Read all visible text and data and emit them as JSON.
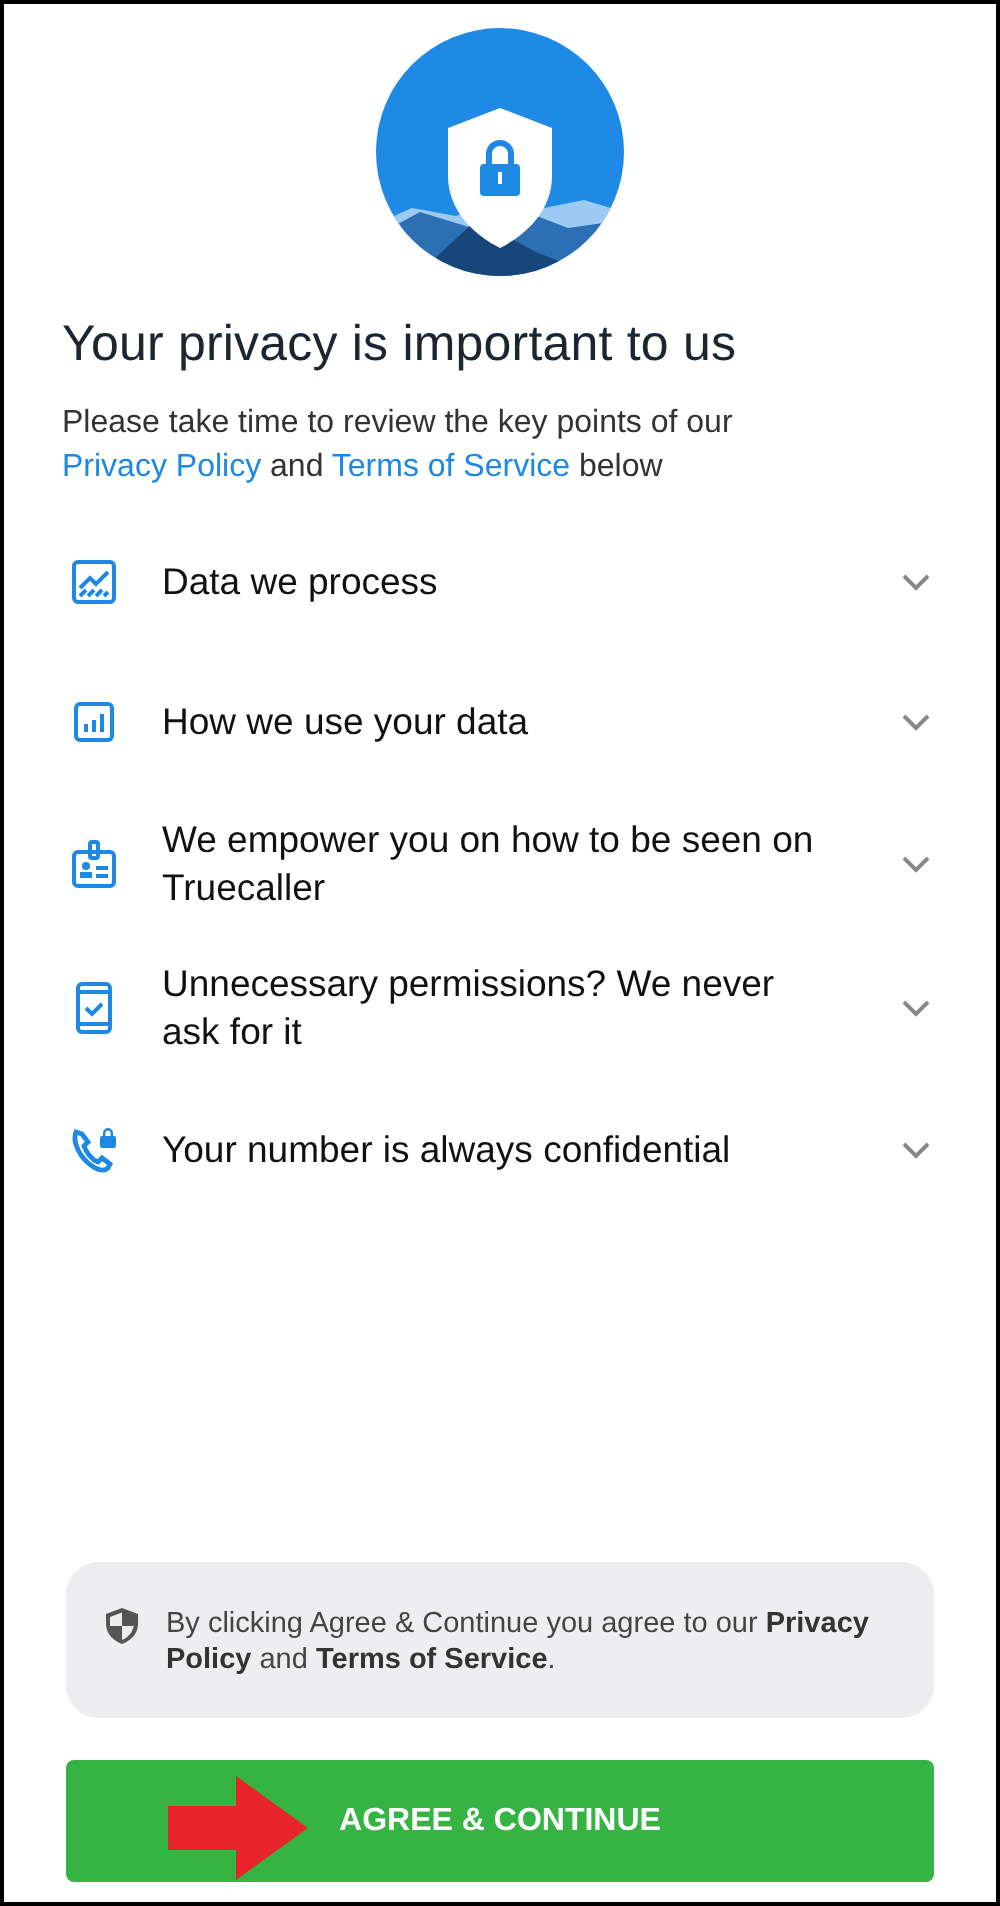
{
  "title": "Your privacy is important to us",
  "intro": [
    {
      "kind": "text",
      "text": "Please take time to review the key points of our"
    },
    {
      "kind": "link",
      "text": "Privacy Policy"
    },
    {
      "kind": "text",
      "text": "and"
    },
    {
      "kind": "link",
      "text": "Terms of Service"
    },
    {
      "kind": "text",
      "text": "below"
    }
  ],
  "sections": [
    {
      "kind": "chart",
      "label": "Data we process",
      "expanded": false
    },
    {
      "kind": "stats",
      "label": "How we use your data",
      "expanded": false
    },
    {
      "kind": "badge",
      "label": "We empower you on how to be seen on Truecaller",
      "expanded": false
    },
    {
      "kind": "phone-check",
      "label": "Unnecessary permissions? We never ask for it",
      "expanded": false
    },
    {
      "kind": "phone-lock",
      "label": "Your number is always confidential",
      "expanded": false
    }
  ],
  "notice": "By clicking Agree & Continue you agree to our **Privacy Policy** and **Terms of Service**.",
  "button": "AGREE & CONTINUE"
}
